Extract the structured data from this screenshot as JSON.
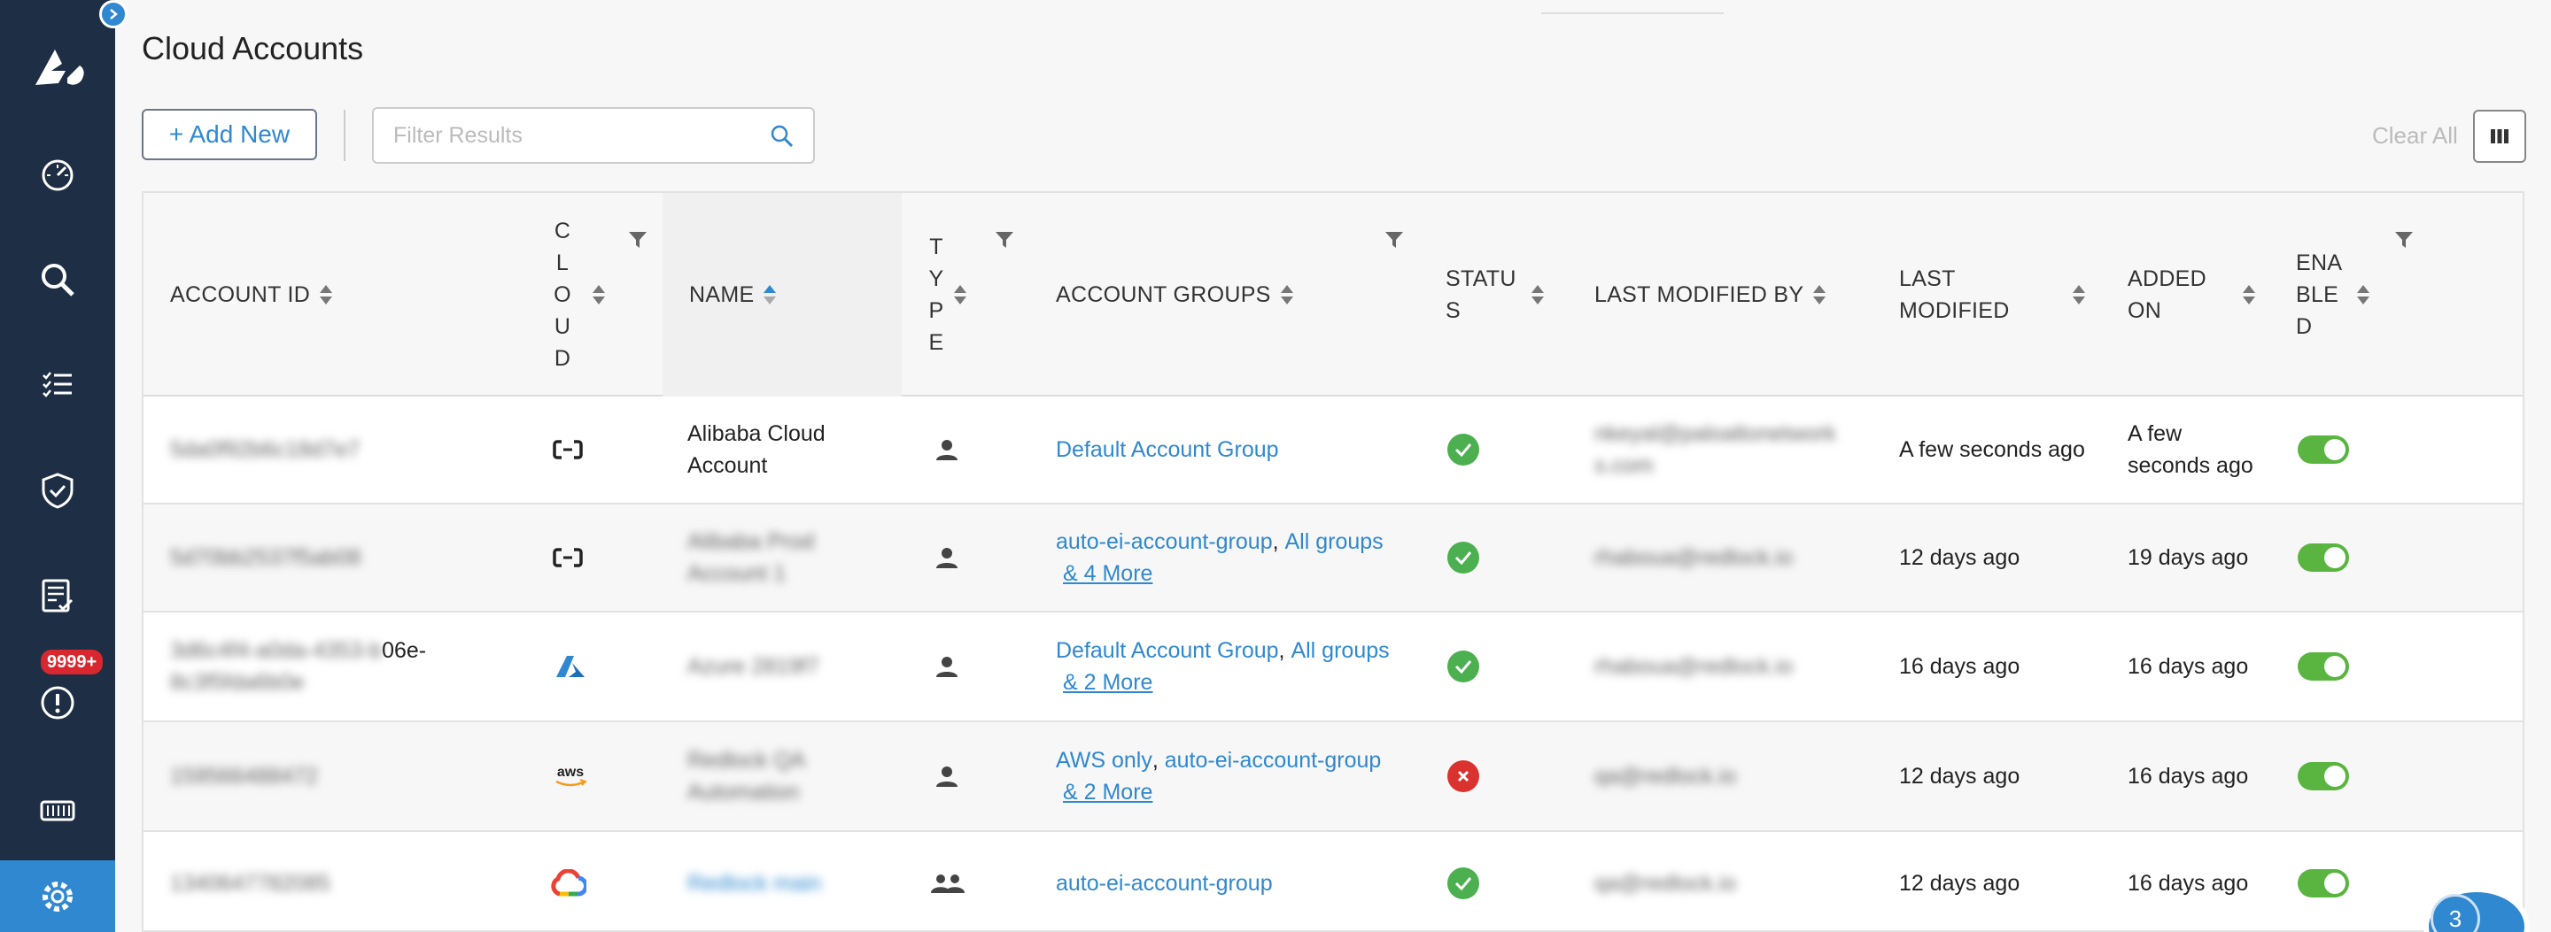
{
  "page": {
    "title": "Cloud Accounts"
  },
  "toolbar": {
    "add_label": "+ Add New",
    "filter_placeholder": "Filter Results",
    "clear_all_label": "Clear All"
  },
  "sidebar": {
    "alerts_badge": "9999+",
    "items": [
      {
        "icon": "dashboard-icon"
      },
      {
        "icon": "search-icon"
      },
      {
        "icon": "checklist-icon"
      },
      {
        "icon": "shield-check-icon"
      },
      {
        "icon": "report-icon"
      },
      {
        "icon": "alert-icon"
      },
      {
        "icon": "compute-icon"
      },
      {
        "icon": "settings-icon"
      }
    ]
  },
  "table": {
    "columns": [
      {
        "key": "account_id",
        "label": "ACCOUNT ID"
      },
      {
        "key": "cloud",
        "label": "C\nL\nO\nU\nD"
      },
      {
        "key": "name",
        "label": "NAME"
      },
      {
        "key": "type",
        "label": "T\nY\nP\nE"
      },
      {
        "key": "account_groups",
        "label": "ACCOUNT GROUPS"
      },
      {
        "key": "status",
        "label": "STATU\nS"
      },
      {
        "key": "last_modified_by",
        "label": "LAST MODIFIED BY"
      },
      {
        "key": "last_modified",
        "label": "LAST\nMODIFIED"
      },
      {
        "key": "added_on",
        "label": "ADDED\nON"
      },
      {
        "key": "enabled",
        "label": "ENA\nBLE\nD"
      }
    ],
    "rows": [
      {
        "account_id": "5da0f92b6c18d7e7",
        "cloud_icon": "alibaba-icon",
        "name": "Alibaba Cloud\nAccount",
        "name_blurred": false,
        "type_icon": "user-icon",
        "groups_main": "Default Account Group",
        "groups_second": "",
        "groups_more": "",
        "status": "ok",
        "last_modified_by": "nkeyal@paloaltonetwork\ns.com",
        "last_modified": "A few seconds ago",
        "added_on": "A few\nseconds ago",
        "enabled": true
      },
      {
        "account_id": "5d70bb2537f5ab08",
        "cloud_icon": "alibaba-icon",
        "name": "Alibaba Prod\nAccount 1",
        "name_blurred": true,
        "type_icon": "user-icon",
        "groups_main": "auto-ei-account-group",
        "groups_second": "All groups",
        "groups_more": "& 4 More",
        "status": "ok",
        "last_modified_by": "rhaboua@redlock.io",
        "last_modified": "12 days ago",
        "added_on": "19 days ago",
        "enabled": true
      },
      {
        "account_id": "3d6c4f4-a0da-4353-b",
        "account_id_suffix": "06e-",
        "account_id_line2": "8c3f5fda6b0e",
        "cloud_icon": "azure-icon",
        "name": "Azure 2819f7",
        "name_blurred": true,
        "type_icon": "user-icon",
        "groups_main": "Default Account Group",
        "groups_second": "All groups",
        "groups_more": "& 2 More",
        "status": "ok",
        "last_modified_by": "rhaboua@redlock.io",
        "last_modified": "16 days ago",
        "added_on": "16 days ago",
        "enabled": true
      },
      {
        "account_id": "159566488472",
        "cloud_icon": "aws-icon",
        "name": "Redlock QA\nAutomation",
        "name_blurred": true,
        "type_icon": "user-icon",
        "groups_main": "AWS only",
        "groups_second": "auto-ei-account-group",
        "groups_more": "& 2 More",
        "status": "error",
        "last_modified_by": "qa@redlock.io",
        "last_modified": "12 days ago",
        "added_on": "16 days ago",
        "enabled": true
      },
      {
        "account_id": "1340647782085",
        "cloud_icon": "gcp-icon",
        "name": "Redlock main",
        "name_blurred": true,
        "name_is_link": true,
        "type_icon": "users-icon",
        "groups_main": "auto-ei-account-group",
        "groups_second": "",
        "groups_more": "",
        "status": "ok",
        "last_modified_by": "qa@redlock.io",
        "last_modified": "12 days ago",
        "added_on": "16 days ago",
        "enabled": true
      }
    ]
  },
  "chat": {
    "count": "3"
  },
  "colors": {
    "sidebar": "#1e2e44",
    "accent": "#2f88d0",
    "toggle_on": "#5ab540",
    "error": "#d9322f",
    "ok": "#4caf50"
  }
}
